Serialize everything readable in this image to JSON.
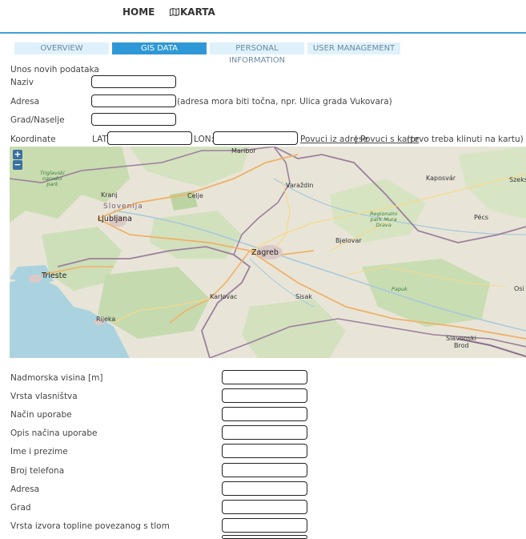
{
  "nav": {
    "home": "HOME",
    "karta": "KARTA",
    "karta_icon": "map-icon"
  },
  "tabs": [
    {
      "label": "OVERVIEW",
      "active": false
    },
    {
      "label": "GIS DATA",
      "active": true
    },
    {
      "label": "PERSONAL INFORMATION",
      "active": false
    },
    {
      "label": "USER MANAGEMENT",
      "active": false
    }
  ],
  "form": {
    "section_title": "Unos novih podataka",
    "naziv_label": "Naziv",
    "adresa_label": "Adresa",
    "adresa_hint": "(adresa mora biti točna, npr. Ulica grada Vukovara)",
    "grad_label": "Grad/Naselje",
    "koordinate_label": "Koordinate",
    "lat_label": "LAT:",
    "lon_label": "LON:",
    "povuci_adresa": "Povuci iz adrese",
    "separator": "|",
    "povuci_karta": "Povuci s karte",
    "karta_hint": "(prvo treba klinuti na kartu)"
  },
  "map": {
    "zoom_in": "+",
    "zoom_out": "−",
    "cities": {
      "maribor": "Maribor",
      "kranj": "Kranj",
      "celje": "Celje",
      "slovenija": "Slovenija",
      "ljubljana": "Ljubljana",
      "varazdin": "Varaždin",
      "kaposvar": "Kaposvár",
      "szeks": "Szeks",
      "pecs": "Pécs",
      "bjelovar": "Bjelovar",
      "zagreb": "Zagreb",
      "trieste": "Trieste",
      "karlovac": "Karlovac",
      "sisak": "Sisak",
      "osi": "Osi",
      "rijeka": "Rijeka",
      "slavonski": "Slavonski",
      "brod": "Brod",
      "papuk": "Papuk"
    },
    "parks": {
      "triglav_1": "Triglavski",
      "triglav_2": "narodni",
      "triglav_3": "park",
      "regional_1": "Regionalni",
      "regional_2": "park Mura",
      "regional_3": "Drava"
    }
  },
  "fields": [
    "Nadmorska visina [m]",
    "Vrsta vlasništva",
    "Način uporabe",
    "Opis načina uporabe",
    "Ime i prezime",
    "Broj telefona",
    "Adresa",
    "Grad",
    "Vrsta izvora topline povezanog s tlom"
  ],
  "colors": {
    "accent": "#2f98d6",
    "tab_inactive": "#dff1fb",
    "divider": "#3fa0d8"
  }
}
